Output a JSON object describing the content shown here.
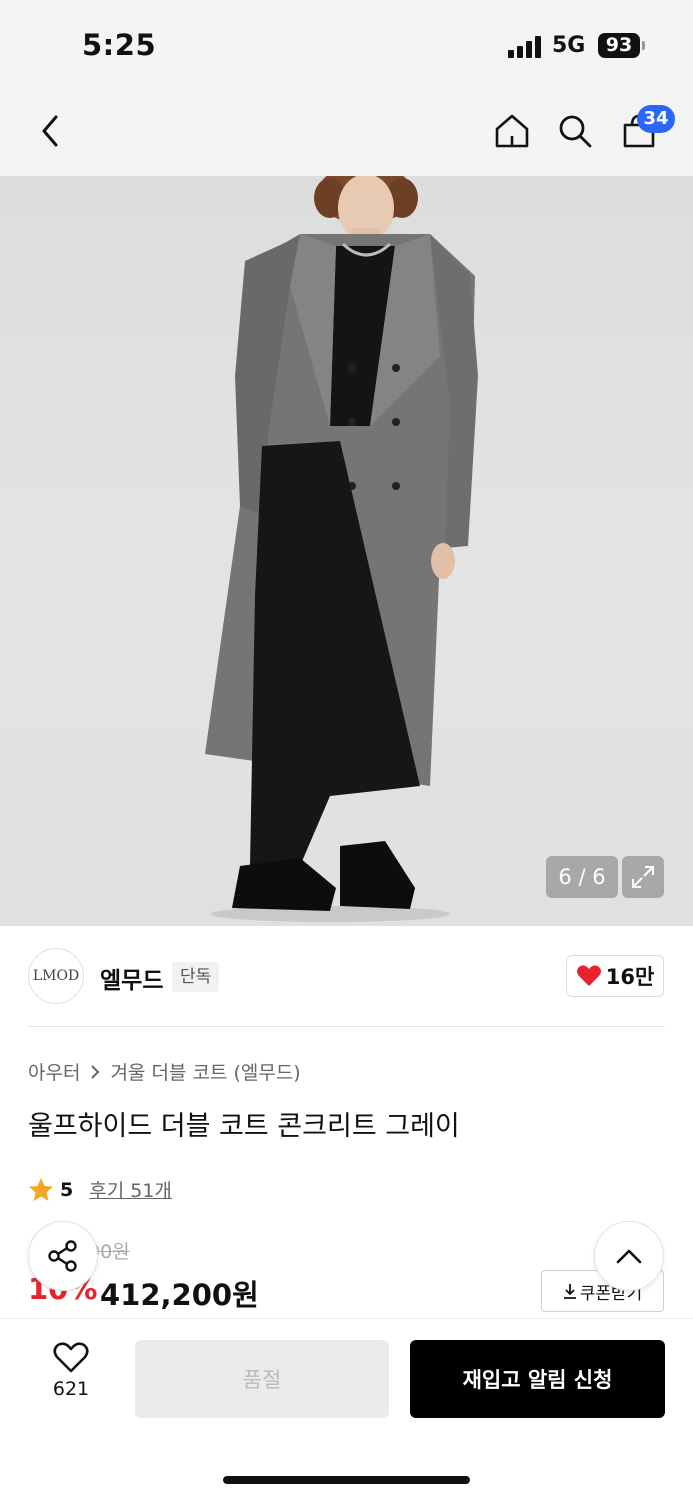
{
  "status_bar": {
    "time": "5:25",
    "network": "5G",
    "battery": "93"
  },
  "nav": {
    "cart_count": "34"
  },
  "gallery": {
    "counter": "6 / 6"
  },
  "brand": {
    "logo_text": "LMOD",
    "name": "엘무드",
    "tag": "단독",
    "likes": "16만"
  },
  "breadcrumb": {
    "category": "아우터",
    "subcategory": "겨울 더블 코트 (엘무드)"
  },
  "product": {
    "title": "울프하이드 더블 코트 콘크리트 그레이",
    "rating": "5",
    "reviews": "후기 51개",
    "original_price_visible": "00원",
    "discount": "10%",
    "price": "412,200원",
    "coupon_label": "쿠폰받기"
  },
  "bottom_bar": {
    "wish_count": "621",
    "soldout_label": "품절",
    "restock_label": "재입고 알림 신청"
  },
  "colors": {
    "accent_blue": "#2b66f6",
    "discount_red": "#e8232e",
    "heart_red": "#e8232e",
    "star": "#f5a623"
  },
  "icons": [
    "chevron-left-icon",
    "home-icon",
    "search-icon",
    "bag-icon",
    "expand-icon",
    "heart-icon",
    "star-icon",
    "share-icon",
    "chevron-up-icon",
    "download-icon",
    "heart-outline-icon"
  ]
}
